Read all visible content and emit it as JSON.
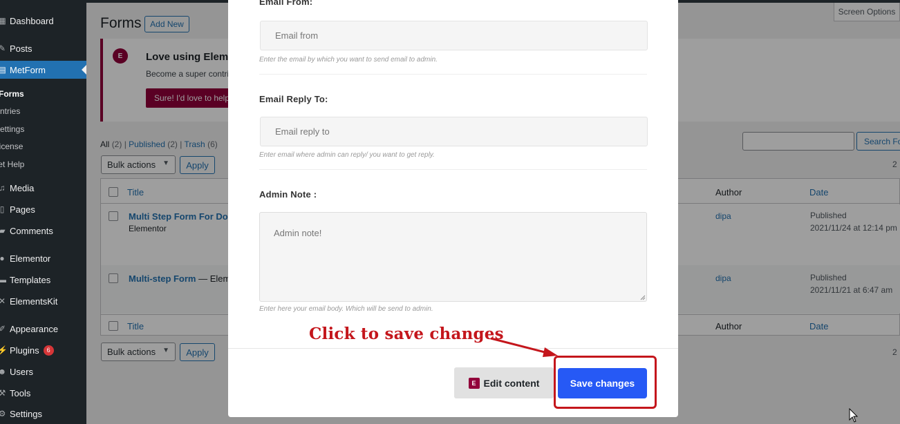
{
  "sidebar": {
    "items": [
      {
        "label": "Dashboard",
        "icon": "dashboard-icon"
      },
      {
        "label": "Posts",
        "icon": "pin-icon"
      },
      {
        "label": "MetForm",
        "icon": "metform-icon"
      },
      {
        "label": "Media",
        "icon": "media-icon"
      },
      {
        "label": "Pages",
        "icon": "page-icon"
      },
      {
        "label": "Comments",
        "icon": "comment-icon"
      },
      {
        "label": "Elementor",
        "icon": "elementor-icon"
      },
      {
        "label": "Templates",
        "icon": "folder-icon"
      },
      {
        "label": "ElementsKit",
        "icon": "elementskit-icon"
      },
      {
        "label": "Appearance",
        "icon": "brush-icon"
      },
      {
        "label": "Plugins",
        "icon": "plugin-icon",
        "badge": "6"
      },
      {
        "label": "Users",
        "icon": "user-icon"
      },
      {
        "label": "Tools",
        "icon": "wrench-icon"
      },
      {
        "label": "Settings",
        "icon": "settings-icon"
      }
    ],
    "submenu": [
      "Forms",
      "Entries",
      "Settings",
      "License",
      "Get Help"
    ]
  },
  "header": {
    "title": "Forms",
    "add_new": "Add New",
    "screen_options": "Screen Options"
  },
  "notice": {
    "title": "Love using Elementor",
    "text": "Become a super contributor",
    "button": "Sure! I'd love to help"
  },
  "filters": {
    "all": "All",
    "all_count": "(2)",
    "published": "Published",
    "published_count": "(2)",
    "trash": "Trash",
    "trash_count": "(6)",
    "sep": "|"
  },
  "bulk": {
    "label": "Bulk actions",
    "apply": "Apply"
  },
  "search_button": "Search Forms",
  "items_count": "2",
  "table": {
    "columns": {
      "title": "Title",
      "author": "Author",
      "date": "Date"
    },
    "rows": [
      {
        "title": "Multi Step Form For Doc",
        "sub": "Elementor",
        "author": "dipa",
        "status": "Published",
        "date": "2021/11/24 at 12:14 pm"
      },
      {
        "title": "Multi-step Form",
        "sub": "— Eleme",
        "author": "dipa",
        "status": "Published",
        "date": "2021/11/21 at 6:47 am"
      }
    ]
  },
  "modal": {
    "email_from_label": "Email From:",
    "email_from_placeholder": "Email from",
    "email_from_help": "Enter the email by which you want to send email to admin.",
    "reply_to_label": "Email Reply To:",
    "reply_to_placeholder": "Email reply to",
    "reply_to_help": "Enter email where admin can reply/ you want to get reply.",
    "admin_note_label": "Admin Note :",
    "admin_note_placeholder": "Admin note!",
    "admin_note_help": "Enter here your email body. Which will be send to admin.",
    "edit_content": "Edit content",
    "save_changes": "Save changes"
  },
  "annotation": {
    "text": "Click to save changes",
    "color": "#c4161c"
  },
  "colors": {
    "admin_dark": "#1d2327",
    "wp_blue": "#2271b1",
    "elementor": "#92003b",
    "save_blue": "#2659f5"
  }
}
